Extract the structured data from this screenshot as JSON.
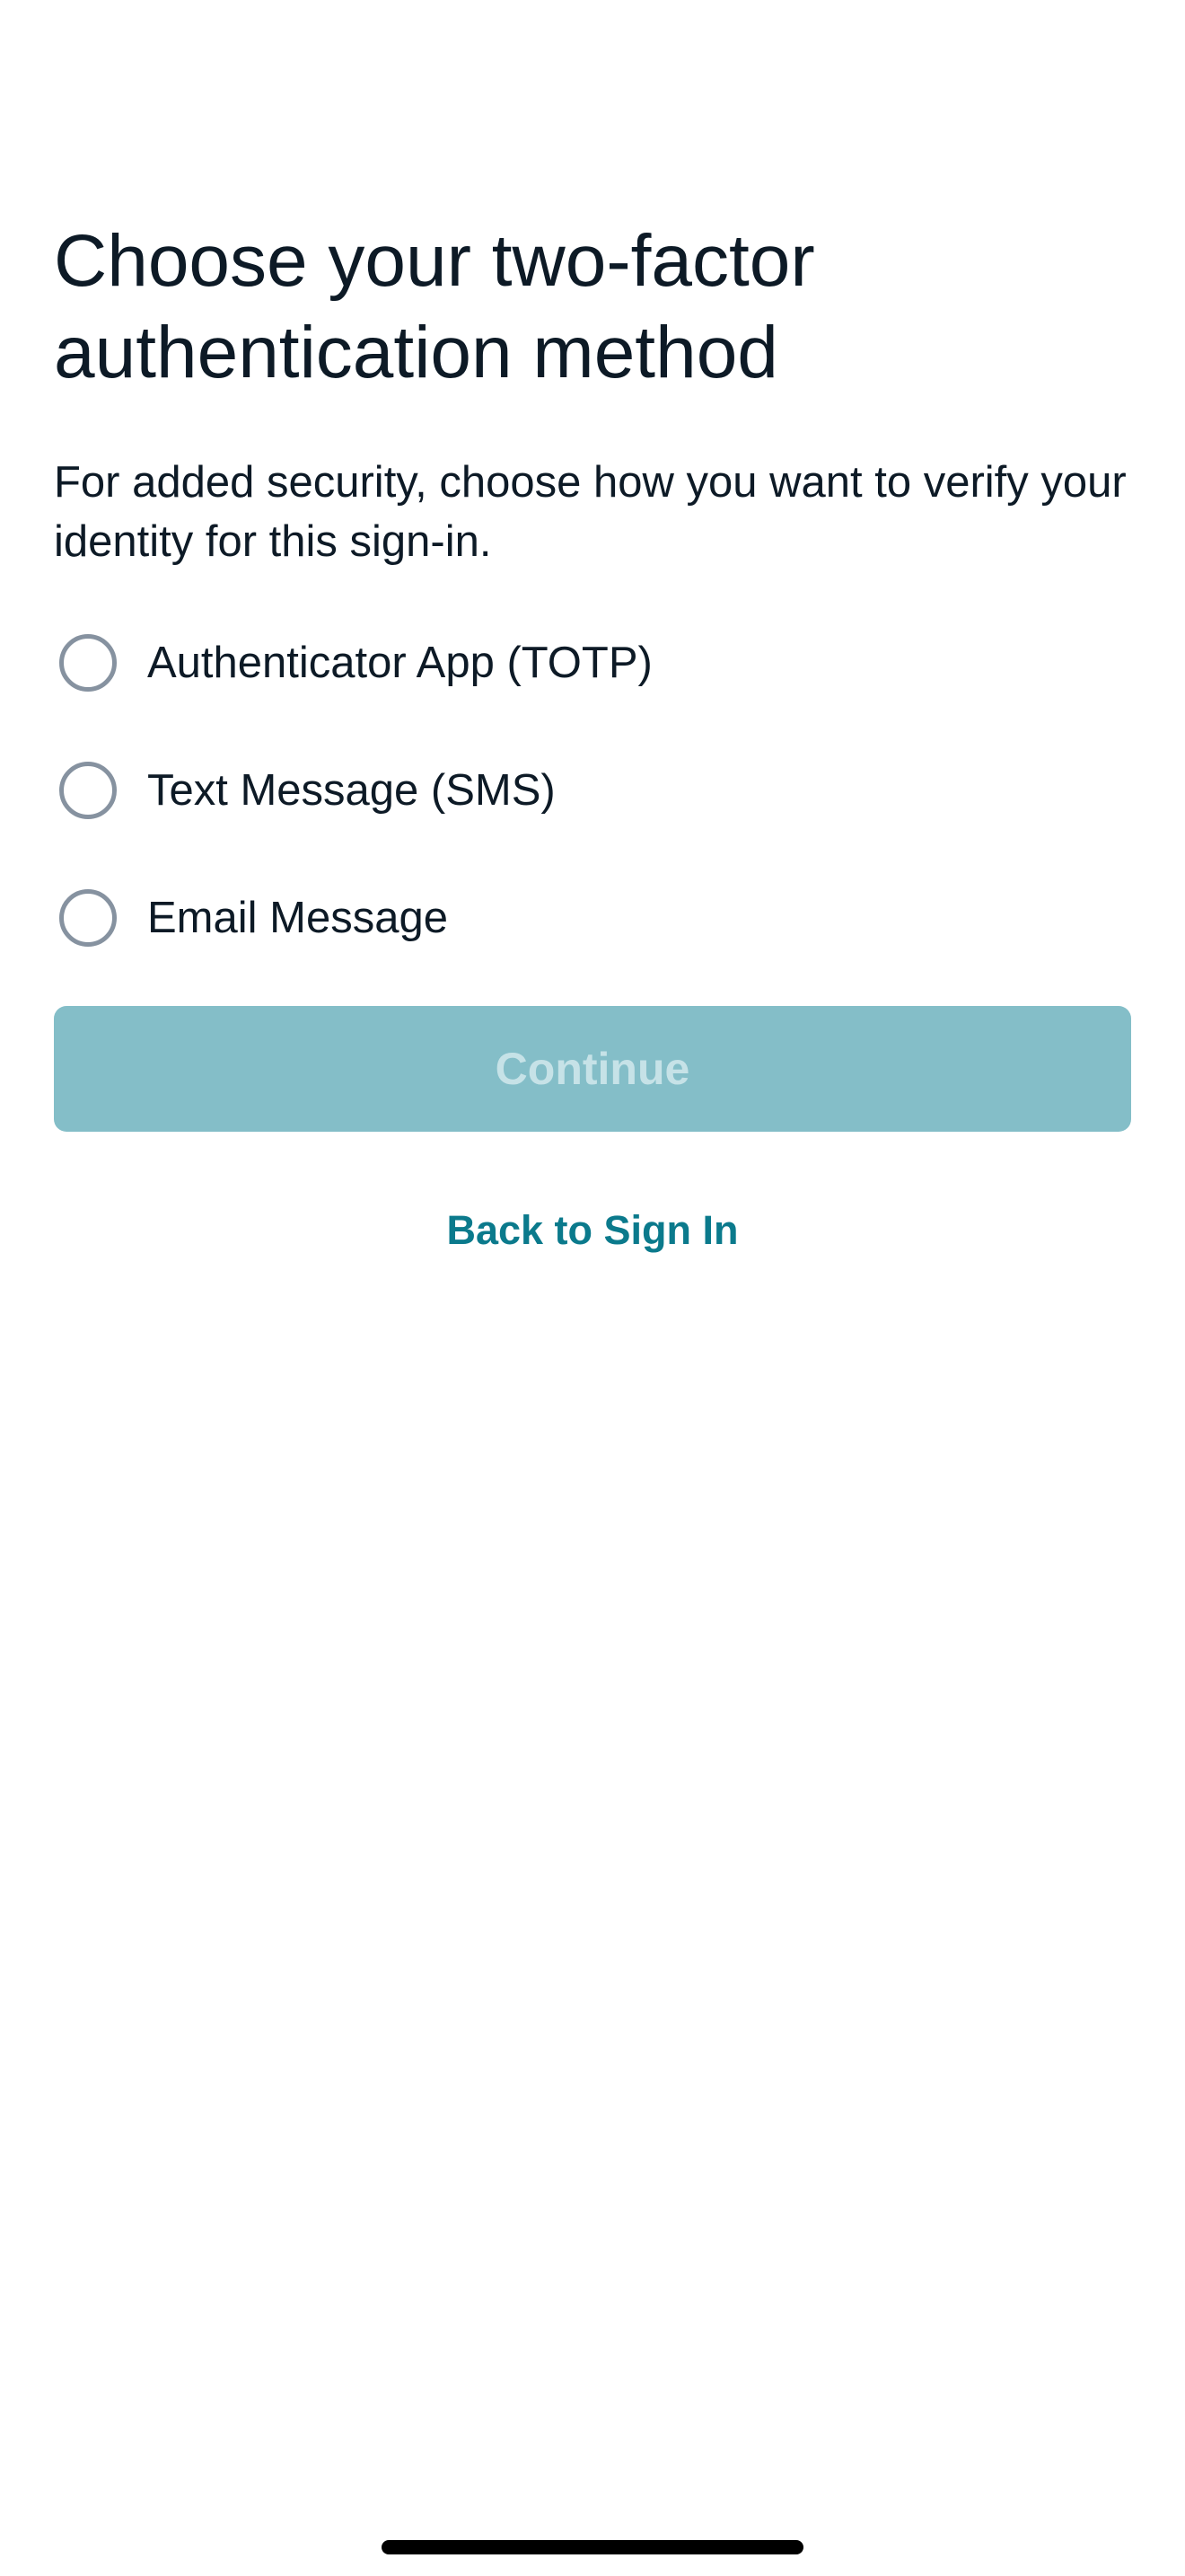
{
  "page": {
    "title": "Choose your two-factor authentication method",
    "subtitle": "For added security, choose how you want to verify your identity for this sign-in."
  },
  "options": [
    {
      "label": "Authenticator App (TOTP)",
      "selected": false
    },
    {
      "label": "Text Message (SMS)",
      "selected": false
    },
    {
      "label": "Email Message",
      "selected": false
    }
  ],
  "actions": {
    "continue_label": "Continue",
    "continue_enabled": false,
    "back_label": "Back to Sign In"
  },
  "colors": {
    "title_text": "#0d1a26",
    "radio_border": "#8692a0",
    "button_disabled_bg": "#84bec8",
    "button_disabled_text": "#c6e2e7",
    "link": "#0b7a8c"
  },
  "icons": {
    "radio": "radio-unselected-icon"
  }
}
